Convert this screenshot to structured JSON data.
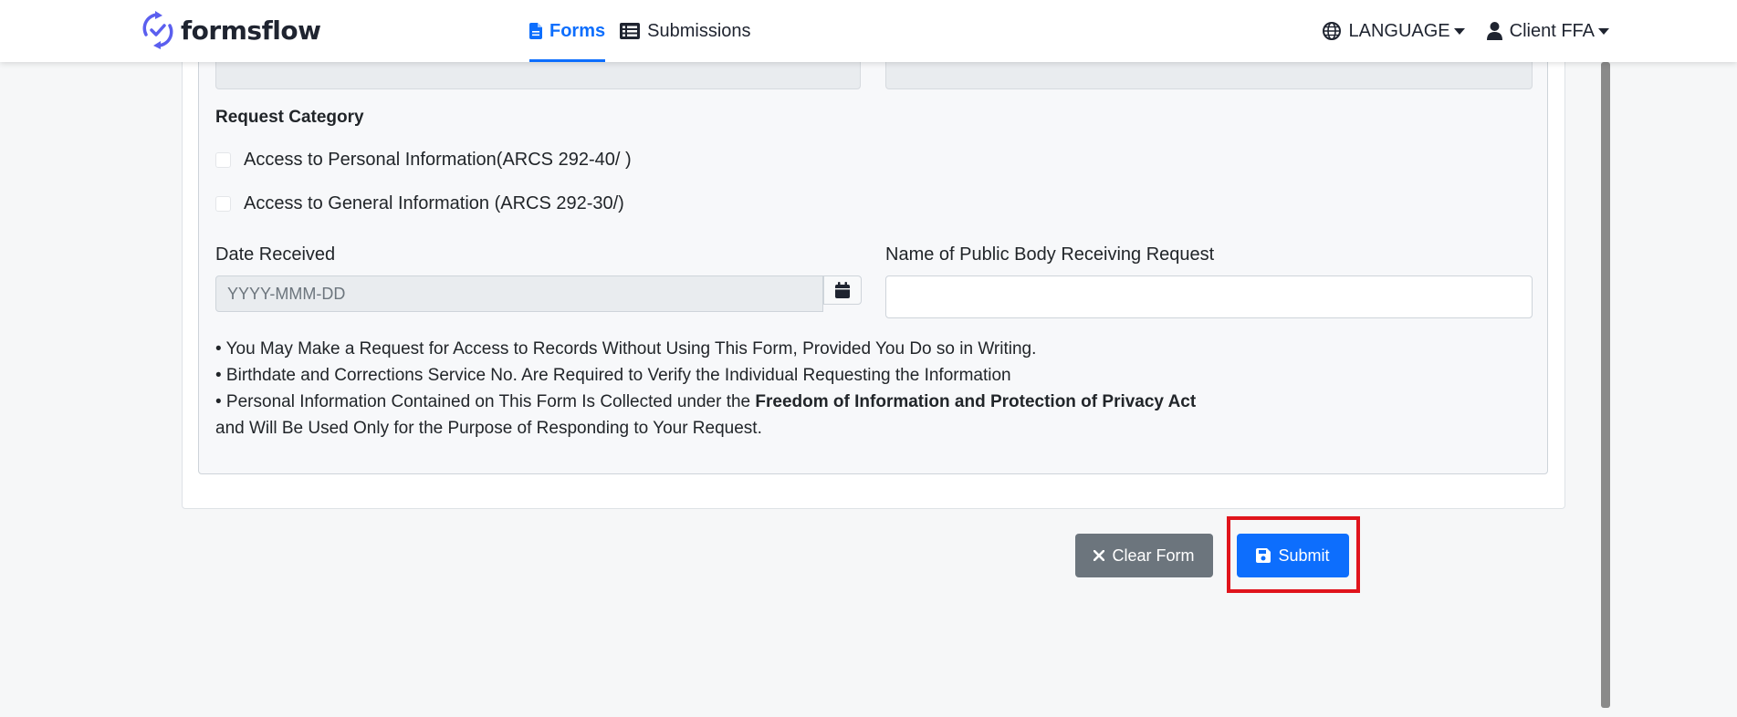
{
  "brand": {
    "name": "formsflow"
  },
  "nav": {
    "links": [
      {
        "label": "Forms",
        "icon": "file-icon",
        "active": true
      },
      {
        "label": "Submissions",
        "icon": "list-icon",
        "active": false
      }
    ],
    "language_label": "LANGUAGE",
    "user_label": "Client FFA"
  },
  "form": {
    "request_category_label": "Request Category",
    "checkboxes": [
      {
        "label": "Access to Personal Information(ARCS 292-40/ )",
        "checked": false
      },
      {
        "label": "Access to General Information (ARCS 292-30/)",
        "checked": false
      }
    ],
    "date_received_label": "Date Received",
    "date_placeholder": "YYYY-MMM-DD",
    "public_body_label": "Name of Public Body Receiving Request",
    "public_body_value": "",
    "notes": {
      "line1": "• You May Make a Request for Access to Records Without Using This Form, Provided You Do so in Writing.",
      "line2": "• Birthdate and Corrections Service No. Are Required to Verify the Individual Requesting the Information",
      "line3_prefix": "• Personal Information Contained on This Form Is Collected under the ",
      "line3_bold": "Freedom of Information and Protection of Privacy Act",
      "line4": "and Will Be Used Only for the Purpose of Responding to Your Request."
    }
  },
  "actions": {
    "clear_label": "Clear Form",
    "submit_label": "Submit"
  },
  "colors": {
    "primary": "#0d6efd",
    "secondary": "#6c757d",
    "highlight": "#e0141c"
  }
}
